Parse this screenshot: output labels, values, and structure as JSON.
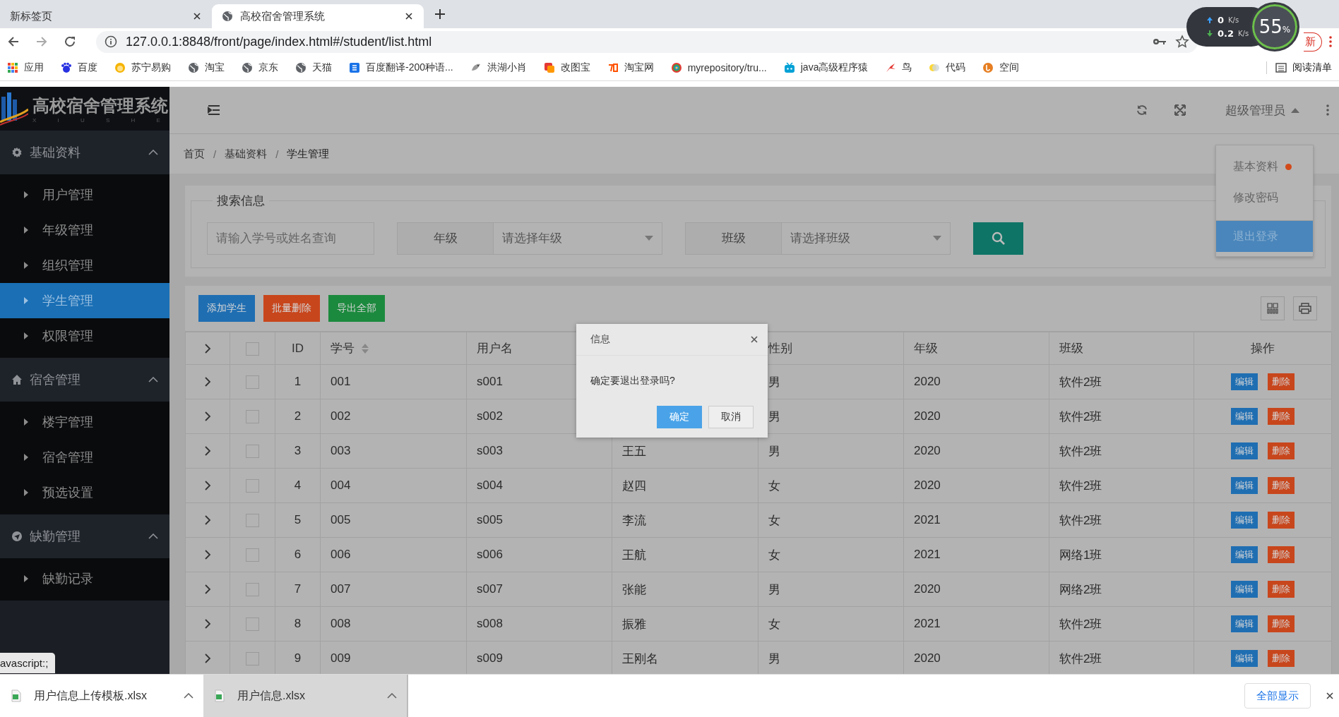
{
  "browser": {
    "tabs": [
      {
        "title": "新标签页",
        "selected": false
      },
      {
        "title": "高校宿舍管理系统",
        "selected": true
      }
    ],
    "address": "127.0.0.1:8848/front/page/index.html#/student/list.html",
    "update_button": "新",
    "bookmarks": [
      {
        "label": "应用"
      },
      {
        "label": "百度"
      },
      {
        "label": "苏宁易购"
      },
      {
        "label": "淘宝"
      },
      {
        "label": "京东"
      },
      {
        "label": "天猫"
      },
      {
        "label": "百度翻译-200种语..."
      },
      {
        "label": "洪湖小肖"
      },
      {
        "label": "改图宝"
      },
      {
        "label": "淘宝网"
      },
      {
        "label": "myrepository/tru..."
      },
      {
        "label": "java高级程序猿"
      },
      {
        "label": "鸟"
      },
      {
        "label": "代码"
      },
      {
        "label": "空间"
      }
    ],
    "reading_list": "阅读清单",
    "net_monitor": {
      "upload": {
        "value": "0",
        "unit": "K/s"
      },
      "download": {
        "value": "0.2",
        "unit": "K/s"
      },
      "load": {
        "value": "55",
        "unit": "%"
      }
    }
  },
  "sidebar": {
    "logo": {
      "title": "高校宿舍管理系统",
      "subtitle": "X I U S H E"
    },
    "groups": [
      {
        "label": "基础资料",
        "expanded": true,
        "items": [
          {
            "label": "用户管理",
            "selected": false
          },
          {
            "label": "年级管理",
            "selected": false
          },
          {
            "label": "组织管理",
            "selected": false
          },
          {
            "label": "学生管理",
            "selected": true
          },
          {
            "label": "权限管理",
            "selected": false
          }
        ]
      },
      {
        "label": "宿舍管理",
        "expanded": true,
        "items": [
          {
            "label": "楼宇管理",
            "selected": false
          },
          {
            "label": "宿舍管理",
            "selected": false
          },
          {
            "label": "预选设置",
            "selected": false
          }
        ]
      },
      {
        "label": "缺勤管理",
        "expanded": true,
        "items": [
          {
            "label": "缺勤记录",
            "selected": false
          }
        ]
      }
    ]
  },
  "header": {
    "user": "超级管理员",
    "user_menu_open": true
  },
  "breadcrumb": {
    "items": [
      "首页",
      "基础资料",
      "学生管理"
    ],
    "separators": [
      "/",
      "/"
    ]
  },
  "search": {
    "legend": "搜索信息",
    "placeholder": "请输入学号或姓名查询",
    "filters": [
      {
        "label": "年级",
        "placeholder": "请选择年级"
      },
      {
        "label": "班级",
        "placeholder": "请选择班级"
      }
    ]
  },
  "toolbar": [
    {
      "label": "添加学生",
      "kind": "primary"
    },
    {
      "label": "批量删除",
      "kind": "danger"
    },
    {
      "label": "导出全部",
      "kind": "success"
    }
  ],
  "table": {
    "all_checked": false,
    "columns": [
      {
        "label": "ID",
        "sortable": false
      },
      {
        "label": "学号",
        "sortable": true
      },
      {
        "label": "用户名",
        "sortable": false
      },
      {},
      {
        "label": "性别",
        "sortable": false
      },
      {
        "label": "年级",
        "sortable": false
      },
      {
        "label": "班级",
        "sortable": false
      },
      {
        "label": "操作",
        "sortable": false
      }
    ],
    "rows": [
      {
        "checked": false,
        "cells": [
          "1",
          "001",
          "s001",
          "",
          "男",
          "2020",
          "软件2班"
        ],
        "actions": [
          "编辑",
          "删除"
        ]
      },
      {
        "checked": false,
        "cells": [
          "2",
          "002",
          "s002",
          "",
          "男",
          "2020",
          "软件2班"
        ],
        "actions": [
          "编辑",
          "删除"
        ]
      },
      {
        "checked": false,
        "cells": [
          "3",
          "003",
          "s003",
          "王五",
          "男",
          "2020",
          "软件2班"
        ],
        "actions": [
          "编辑",
          "删除"
        ]
      },
      {
        "checked": false,
        "cells": [
          "4",
          "004",
          "s004",
          "赵四",
          "女",
          "2020",
          "软件2班"
        ],
        "actions": [
          "编辑",
          "删除"
        ]
      },
      {
        "checked": false,
        "cells": [
          "5",
          "005",
          "s005",
          "李流",
          "女",
          "2021",
          "软件2班"
        ],
        "actions": [
          "编辑",
          "删除"
        ]
      },
      {
        "checked": false,
        "cells": [
          "6",
          "006",
          "s006",
          "王航",
          "女",
          "2021",
          "网络1班"
        ],
        "actions": [
          "编辑",
          "删除"
        ]
      },
      {
        "checked": false,
        "cells": [
          "7",
          "007",
          "s007",
          "张能",
          "男",
          "2020",
          "网络2班"
        ],
        "actions": [
          "编辑",
          "删除"
        ]
      },
      {
        "checked": false,
        "cells": [
          "8",
          "008",
          "s008",
          "振雅",
          "女",
          "2021",
          "软件2班"
        ],
        "actions": [
          "编辑",
          "删除"
        ]
      },
      {
        "checked": false,
        "cells": [
          "9",
          "009",
          "s009",
          "王刚名",
          "男",
          "2020",
          "软件2班"
        ],
        "actions": [
          "编辑",
          "删除"
        ]
      }
    ]
  },
  "user_menu": {
    "items": [
      {
        "label": "基本资料",
        "dot": true,
        "selected": false
      },
      {
        "label": "修改密码",
        "dot": false,
        "selected": false
      },
      {
        "label": "退出登录",
        "dot": false,
        "selected": true
      }
    ]
  },
  "dialog": {
    "title": "信息",
    "message": "确定要退出登录吗?",
    "buttons": [
      {
        "label": "确定",
        "kind": "primary"
      },
      {
        "label": "取消",
        "kind": "default"
      }
    ]
  },
  "status_url": "avascript:;",
  "downloads": {
    "items": [
      {
        "name": "用户信息上传模板.xlsx",
        "selected": false
      },
      {
        "name": "用户信息.xlsx",
        "selected": true
      }
    ],
    "show_all": "全部显示"
  }
}
